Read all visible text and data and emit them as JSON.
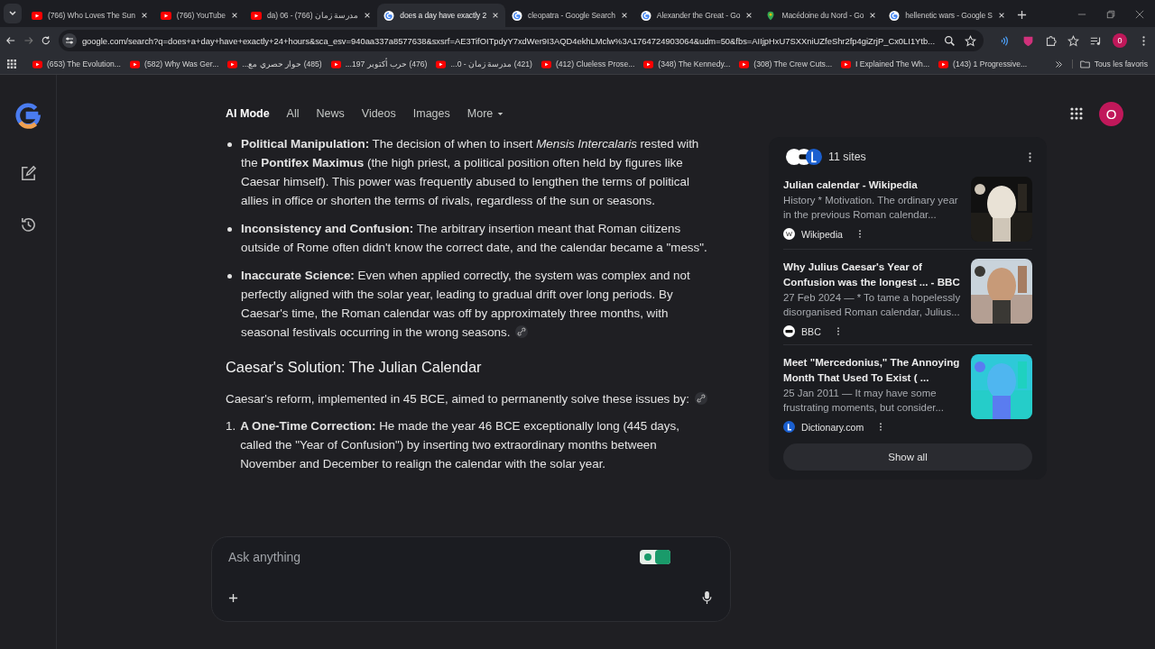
{
  "tabs": [
    {
      "title": "(766) Who Loves The Sun",
      "kind": "youtube",
      "selected": false
    },
    {
      "title": "(766) YouTube",
      "kind": "youtube",
      "selected": false
    },
    {
      "title": "da) 06 - مدرسة زمان (766)",
      "kind": "youtube",
      "selected": false
    },
    {
      "title": "does a day have exactly 2",
      "kind": "google",
      "selected": true
    },
    {
      "title": "cleopatra - Google Search",
      "kind": "google",
      "selected": false
    },
    {
      "title": "Alexander the Great - Go",
      "kind": "google",
      "selected": false
    },
    {
      "title": "Macédoine du Nord - Go",
      "kind": "maps",
      "selected": false
    },
    {
      "title": "hellenetic wars - Google S",
      "kind": "google",
      "selected": false
    }
  ],
  "address": "google.com/search?q=does+a+day+have+exactly+24+hours&sca_esv=940aa337a8577638&sxsrf=AE3TifOITpdyY7xdWer9I3AQD4ekhLMclw%3A1764724903064&udm=50&fbs=AIIjpHxU7SXXniUZfeShr2fp4giZrjP_Cx0LI1Ytb...",
  "profile": "0",
  "bookmarks": [
    "(653) The Evolution...",
    "(582) Why Was Ger...",
    "(485) حوار حصري مع...",
    "(476) حرب أكتوبر 197...",
    "(421) مدرسة زمان - 0...",
    "(412) Clueless Prose...",
    "(348) The Kennedy...",
    "(308) The Crew Cuts...",
    "I Explained The Wh...",
    "(143) 1 Progressive..."
  ],
  "all_bookmarks": "Tous les favoris",
  "nav": [
    {
      "label": "AI Mode",
      "selected": true
    },
    {
      "label": "All",
      "selected": false
    },
    {
      "label": "News",
      "selected": false
    },
    {
      "label": "Videos",
      "selected": false
    },
    {
      "label": "Images",
      "selected": false
    },
    {
      "label": "More",
      "selected": false
    }
  ],
  "account": "O",
  "bullets": [
    "**Political Manipulation:** The decision of when to insert *Mensis Intercalaris* rested with the **Pontifex Maximus** (the high priest, a political position often held by figures like Caesar himself). This power was frequently abused to lengthen the terms of political allies in office or shorten the terms of rivals, regardless of the sun or seasons.",
    "**Inconsistency and Confusion:** The arbitrary insertion meant that Roman citizens outside of Rome often didn't know the correct date, and the calendar became a \"mess\".",
    "**Inaccurate Science:** Even when applied correctly, the system was complex and not perfectly aligned with the solar year, leading to gradual drift over long periods. By Caesar's time, the Roman calendar was off by approximately three months, with seasonal festivals occurring in the wrong seasons."
  ],
  "heading": "Caesar's Solution: The Julian Calendar",
  "intro": "Caesar's reform, implemented in 45 BCE, aimed to permanently solve these issues by:",
  "steps": [
    {
      "number": "1.",
      "text": "**A One-Time Correction:** He made the year 46 BCE exceptionally long (445 days, called the \"Year of Confusion\") by inserting two extraordinary months between November and December to realign the calendar with the solar year."
    }
  ],
  "sources": {
    "count": "11 sites",
    "items": [
      {
        "title": "Julian calendar - Wikipedia",
        "snippet": "History * Motivation. The ordinary year in the previous Roman calendar...",
        "site": "Wikipedia",
        "kind": "wiki"
      },
      {
        "title": "Why Julius Caesar's Year of Confusion was the longest ... - BBC",
        "snippet": "27 Feb 2024 — * To tame a hopelessly disorganised Roman calendar, Julius...",
        "site": "BBC",
        "kind": "bbc"
      },
      {
        "title": "Meet \"Mercedonius,\" The Annoying Month That Used To Exist ( ...",
        "snippet": "25 Jan 2011 — It may have some frustrating moments, but consider...",
        "site": "Dictionary.com",
        "kind": "dict"
      }
    ],
    "show_all": "Show all"
  },
  "ask": {
    "placeholder": "Ask anything"
  }
}
